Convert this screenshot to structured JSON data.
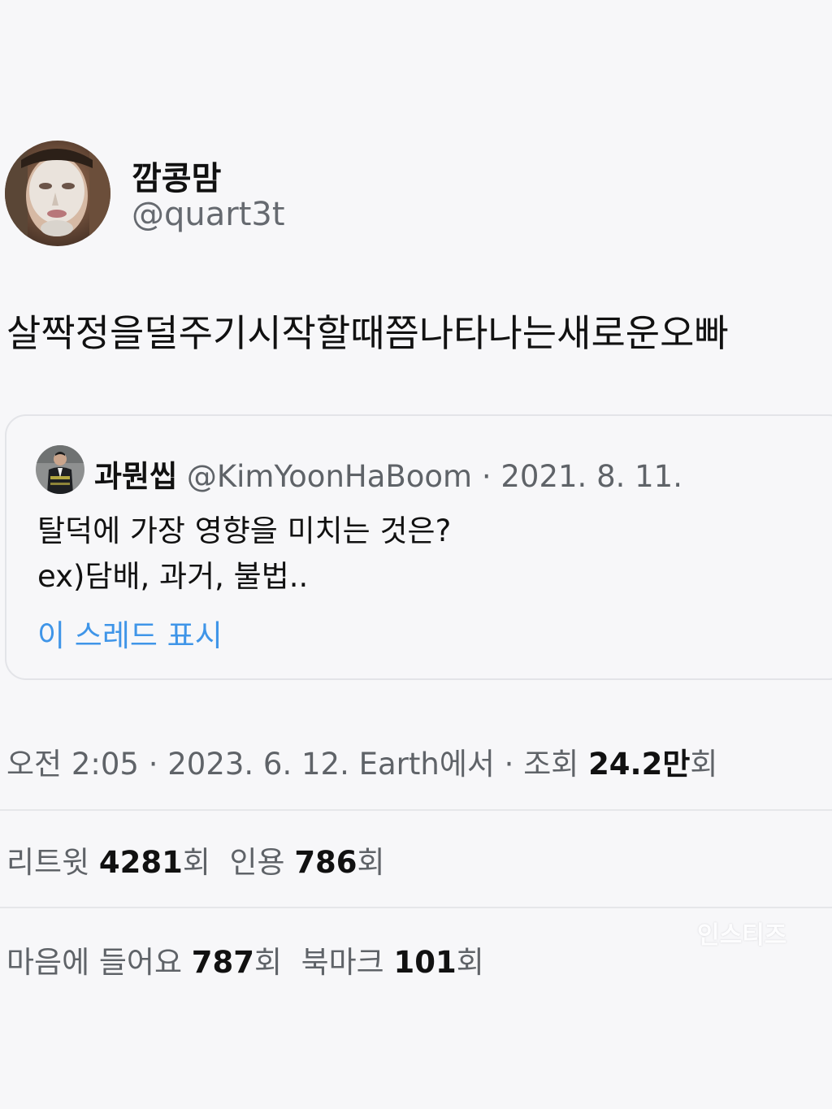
{
  "tweet": {
    "author": {
      "display_name": "깜콩맘",
      "handle": "@quart3t"
    },
    "text": "살짝정을덜주기시작할때쯤나타나는새로운오빠",
    "quote": {
      "display_name": "과뭔씹",
      "handle": "@KimYoonHaBoom",
      "separator": "·",
      "date": "2021. 8. 11.",
      "lines": [
        "탈덕에 가장 영향을 미치는 것은?",
        "ex)담배, 과거, 불법.."
      ],
      "show_thread": "이 스레드 표시"
    },
    "meta": {
      "time": "오전 2:05",
      "separator": "·",
      "date": "2023. 6. 12.",
      "source": "Earth에서",
      "views_label": "조회",
      "views_value": "24.2만",
      "views_suffix": "회"
    },
    "stats": {
      "retweets_label": "리트윗",
      "retweets_value": "4281",
      "retweets_suffix": "회",
      "quotes_label": "인용",
      "quotes_value": "786",
      "quotes_suffix": "회",
      "likes_label": "마음에 들어요",
      "likes_value": "787",
      "likes_suffix": "회",
      "bookmarks_label": "북마크",
      "bookmarks_value": "101",
      "bookmarks_suffix": "회"
    }
  },
  "watermark": "인스티즈",
  "colors": {
    "background": "#f7f7f9",
    "link": "#3f95e8",
    "muted": "#5f6368",
    "divider": "#e6e7ea"
  },
  "icons": {
    "author_avatar": "face-mask-avatar",
    "quote_avatar": "suited-man-avatar"
  }
}
